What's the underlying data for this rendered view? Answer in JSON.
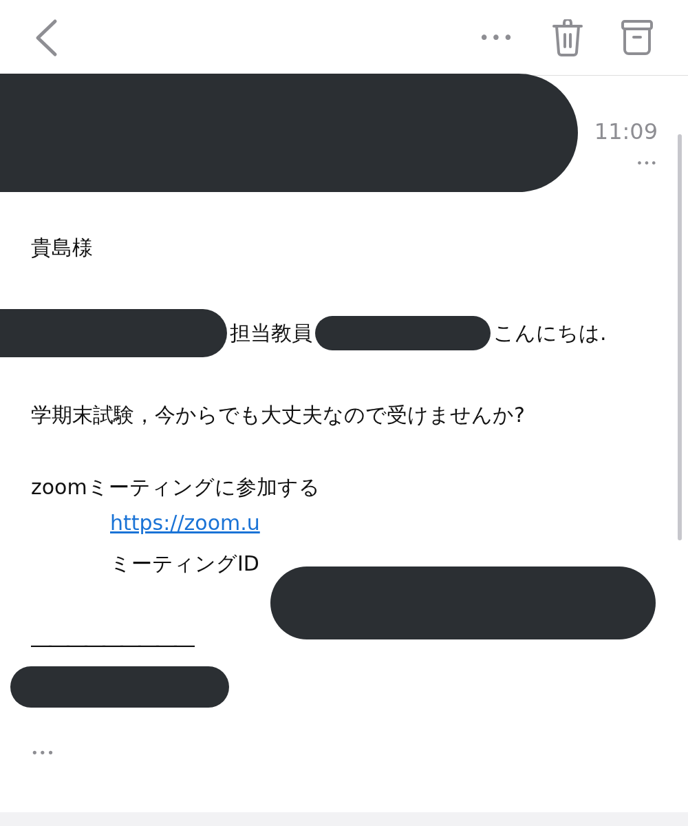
{
  "header": {
    "more": "•••"
  },
  "message": {
    "time": "11:09",
    "details": "•••",
    "greeting": "貴島様",
    "intro": [
      "担当教員",
      "こんにちは."
    ],
    "question": "学期末試験，今からでも大丈夫なので受けませんか?",
    "invite": "zoomミーティングに参加する",
    "link": "https://zoom.u",
    "meeting_id": "ミーティングID",
    "rule": "―――――――――",
    "footer_more": "•••"
  }
}
